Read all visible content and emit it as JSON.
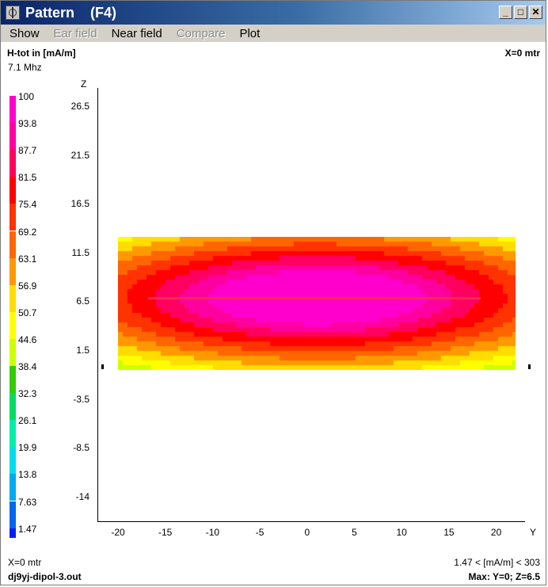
{
  "window": {
    "title": "Pattern    (F4)",
    "buttons": [
      "_",
      "□",
      "✕"
    ]
  },
  "menu": [
    {
      "label": "Show",
      "enabled": true
    },
    {
      "label": "Ear field",
      "enabled": false
    },
    {
      "label": "Near field",
      "enabled": true
    },
    {
      "label": "Compare",
      "enabled": false
    },
    {
      "label": "Plot",
      "enabled": true
    }
  ],
  "header": {
    "quantity": "H-tot in [mA/m]",
    "frequency": "7.1 Mhz",
    "plane": "X=0 mtr"
  },
  "legend": {
    "labels": [
      "100",
      "93.8",
      "87.7",
      "81.5",
      "75.4",
      "69.2",
      "63.1",
      "56.9",
      "50.7",
      "44.6",
      "38.4",
      "32.3",
      "26.1",
      "19.9",
      "13.8",
      "7.63",
      "1.47"
    ],
    "colors": [
      "#ff00cc",
      "#ff00a0",
      "#ff0060",
      "#ff0000",
      "#ff3300",
      "#ff6600",
      "#ff9900",
      "#ffdd00",
      "#ffff00",
      "#ccff00",
      "#33cc00",
      "#00dd66",
      "#00eeaa",
      "#00ddee",
      "#00aaee",
      "#0066ee",
      "#0022ee"
    ]
  },
  "axes": {
    "z_label": "Z",
    "y_label": "Y",
    "z_ticks": [
      "26.5",
      "21.5",
      "16.5",
      "11.5",
      "6.5",
      "1.5",
      "-3.5",
      "-8.5",
      "-14"
    ],
    "y_ticks": [
      "-20",
      "-15",
      "-10",
      "-5",
      "0",
      "5",
      "10",
      "15",
      "20"
    ]
  },
  "footer": {
    "plane": "X=0 mtr",
    "file": "dj9yj-dipol-3.out",
    "range": "1.47 < [mA/m] < 303",
    "max": "Max: Y=0; Z=6.5"
  }
}
